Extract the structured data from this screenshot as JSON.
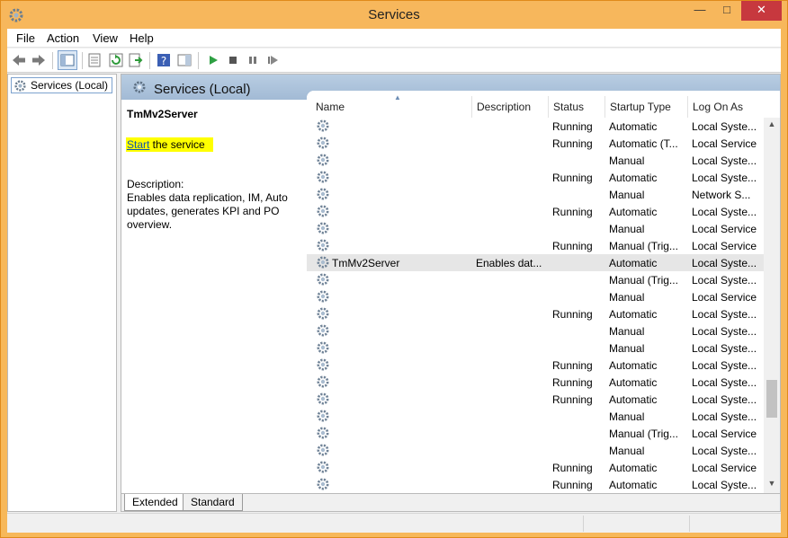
{
  "window": {
    "title": "Services",
    "minimize": "—",
    "maximize": "□",
    "close": "✕"
  },
  "menu": [
    "File",
    "Action",
    "View",
    "Help"
  ],
  "toolbar": {
    "icons": [
      "back-icon",
      "forward-icon",
      "show-hide-tree-icon",
      "properties-icon",
      "refresh-icon",
      "export-list-icon",
      "help-icon",
      "show-action-pane-icon",
      "start-service-icon",
      "stop-service-icon",
      "pause-service-icon",
      "restart-service-icon"
    ]
  },
  "tree": {
    "root_label": "Services (Local)"
  },
  "pane": {
    "header": "Services (Local)"
  },
  "detail": {
    "service_name": "TmMv2Server",
    "action_link": "Start",
    "action_rest": " the service",
    "description_label": "Description:",
    "description": "Enables data replication, IM, Auto updates, generates KPI and PO overview."
  },
  "columns": {
    "name": "Name",
    "description": "Description",
    "status": "Status",
    "startup_type": "Startup Type",
    "log_on_as": "Log On As"
  },
  "rows": [
    {
      "name": "",
      "description": "",
      "status": "Running",
      "startup": "Automatic",
      "logon": "Local Syste..."
    },
    {
      "name": "",
      "description": "",
      "status": "Running",
      "startup": "Automatic (T...",
      "logon": "Local Service"
    },
    {
      "name": "",
      "description": "",
      "status": "",
      "startup": "Manual",
      "logon": "Local Syste..."
    },
    {
      "name": "",
      "description": "",
      "status": "Running",
      "startup": "Automatic",
      "logon": "Local Syste..."
    },
    {
      "name": "",
      "description": "",
      "status": "",
      "startup": "Manual",
      "logon": "Network S..."
    },
    {
      "name": "",
      "description": "",
      "status": "Running",
      "startup": "Automatic",
      "logon": "Local Syste..."
    },
    {
      "name": "",
      "description": "",
      "status": "",
      "startup": "Manual",
      "logon": "Local Service"
    },
    {
      "name": "",
      "description": "",
      "status": "Running",
      "startup": "Manual (Trig...",
      "logon": "Local Service"
    },
    {
      "name": "TmMv2Server",
      "description": "Enables dat...",
      "status": "",
      "startup": "Automatic",
      "logon": "Local Syste...",
      "selected": true
    },
    {
      "name": "",
      "description": "",
      "status": "",
      "startup": "Manual (Trig...",
      "logon": "Local Syste..."
    },
    {
      "name": "",
      "description": "",
      "status": "",
      "startup": "Manual",
      "logon": "Local Service"
    },
    {
      "name": "",
      "description": "",
      "status": "Running",
      "startup": "Automatic",
      "logon": "Local Syste..."
    },
    {
      "name": "",
      "description": "",
      "status": "",
      "startup": "Manual",
      "logon": "Local Syste..."
    },
    {
      "name": "",
      "description": "",
      "status": "",
      "startup": "Manual",
      "logon": "Local Syste..."
    },
    {
      "name": "",
      "description": "",
      "status": "Running",
      "startup": "Automatic",
      "logon": "Local Syste..."
    },
    {
      "name": "",
      "description": "",
      "status": "Running",
      "startup": "Automatic",
      "logon": "Local Syste..."
    },
    {
      "name": "",
      "description": "",
      "status": "Running",
      "startup": "Automatic",
      "logon": "Local Syste..."
    },
    {
      "name": "",
      "description": "",
      "status": "",
      "startup": "Manual",
      "logon": "Local Syste..."
    },
    {
      "name": "",
      "description": "",
      "status": "",
      "startup": "Manual (Trig...",
      "logon": "Local Service"
    },
    {
      "name": "",
      "description": "",
      "status": "",
      "startup": "Manual",
      "logon": "Local Syste..."
    },
    {
      "name": "",
      "description": "",
      "status": "Running",
      "startup": "Automatic",
      "logon": "Local Service"
    },
    {
      "name": "",
      "description": "",
      "status": "Running",
      "startup": "Automatic",
      "logon": "Local Syste..."
    }
  ],
  "tabs": {
    "extended": "Extended",
    "standard": "Standard"
  },
  "colors": {
    "title_bar": "#f7b75c",
    "close_button": "#c7383e",
    "pane_header": "#a2bad5",
    "highlight": "#ffff00",
    "selected_row": "#e6e6e6"
  }
}
